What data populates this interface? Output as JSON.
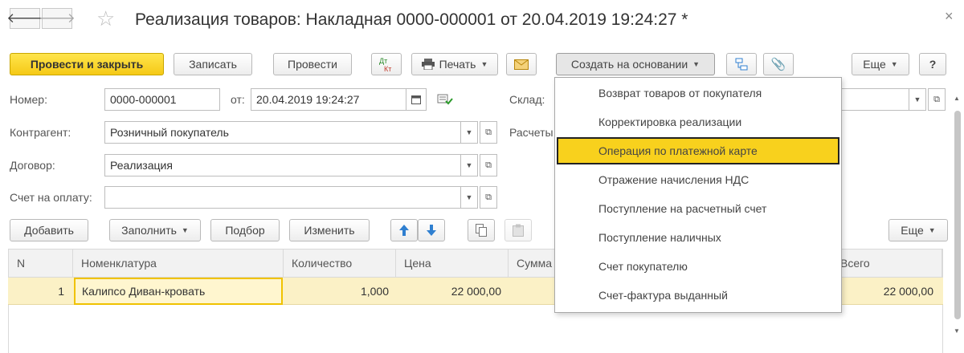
{
  "window": {
    "title": "Реализация товаров: Накладная 0000-000001 от 20.04.2019 19:24:27 *",
    "back_icon": "arrow-left-icon",
    "forward_icon": "arrow-right-icon",
    "favorite_icon": "star-icon",
    "close_symbol": "×"
  },
  "toolbar": {
    "post_close": "Провести и закрыть",
    "save": "Записать",
    "post": "Провести",
    "dtkt_top": "Дт",
    "dtkt_bottom": "Кт",
    "print": "Печать",
    "create_based": "Создать на основании",
    "more": "Еще",
    "help": "?"
  },
  "form": {
    "number_label": "Номер:",
    "number_value": "0000-000001",
    "date_label": "от:",
    "date_value": "20.04.2019 19:24:27",
    "warehouse_label": "Склад:",
    "counterparty_label": "Контрагент:",
    "counterparty_value": "Розничный покупатель",
    "settlements_label": "Расчеты",
    "contract_label": "Договор:",
    "contract_value": "Реализация",
    "invoice_label": "Счет на оплату:",
    "invoice_value": ""
  },
  "table_toolbar": {
    "add": "Добавить",
    "fill": "Заполнить",
    "pick": "Подбор",
    "edit": "Изменить",
    "more": "Еще"
  },
  "table": {
    "columns": [
      "N",
      "Номенклатура",
      "Количество",
      "Цена",
      "Сумма",
      "Всего"
    ],
    "rows": [
      {
        "n": "1",
        "item": "Калипсо Диван-кровать",
        "qty": "1,000",
        "price": "22 000,00",
        "total": "22 000,00"
      }
    ]
  },
  "create_menu": {
    "items": [
      "Возврат товаров от покупателя",
      "Корректировка реализации",
      "Операция по платежной карте",
      "Отражение начисления НДС",
      "Поступление на расчетный счет",
      "Поступление наличных",
      "Счет покупателю",
      "Счет-фактура выданный"
    ],
    "active_index": 2
  },
  "colors": {
    "primary_button": "#f5c916",
    "menu_highlight": "#f8d11d",
    "row_selected": "#fbf1c6",
    "arrow_blue": "#2f7fd0"
  }
}
